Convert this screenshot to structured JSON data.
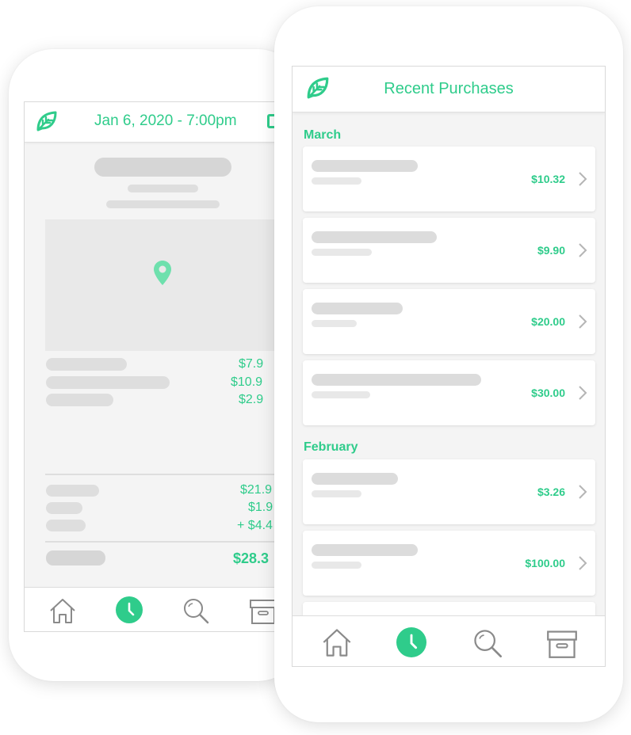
{
  "colors": {
    "accent": "#2fcc8b",
    "placeholder": "#dedede",
    "icon": "#8a8a8a"
  },
  "back_screen": {
    "header_title": "Jan 6, 2020 - 7:00pm",
    "icons": [
      "leaf-logo-icon",
      "map-pin-icon",
      "calendar-icon"
    ],
    "item_prices": [
      "$7.9",
      "$10.9",
      "$2.9"
    ],
    "summary_prices": [
      "$21.9",
      "$1.9",
      "+ $4.4"
    ],
    "total": "$28.3"
  },
  "front_screen": {
    "header_title": "Recent Purchases",
    "sections": [
      {
        "label": "March",
        "purchases": [
          {
            "amount": "$10.32"
          },
          {
            "amount": "$9.90"
          },
          {
            "amount": "$20.00"
          },
          {
            "amount": "$30.00"
          }
        ]
      },
      {
        "label": "February",
        "purchases": [
          {
            "amount": "$3.26"
          },
          {
            "amount": "$100.00"
          }
        ]
      }
    ]
  },
  "tab_bar": {
    "tabs": [
      {
        "icon": "home-icon"
      },
      {
        "icon": "clock-icon",
        "active": true
      },
      {
        "icon": "search-icon"
      },
      {
        "icon": "archive-box-icon"
      }
    ]
  }
}
